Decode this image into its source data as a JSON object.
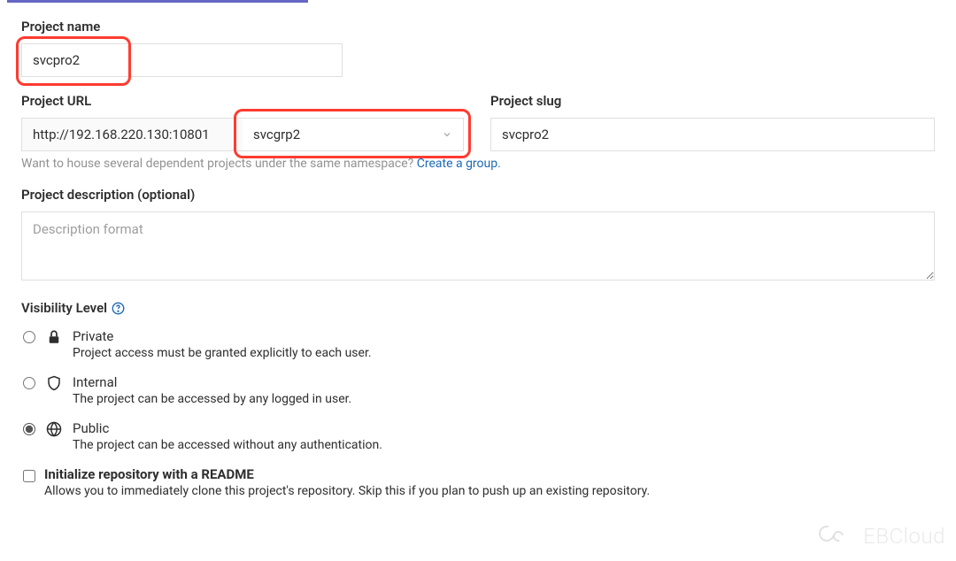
{
  "projectName": {
    "label": "Project name",
    "value": "svcpro2"
  },
  "projectUrl": {
    "label": "Project URL",
    "prefix": "http://192.168.220.130:10801",
    "namespace": "svcgrp2"
  },
  "projectSlug": {
    "label": "Project slug",
    "value": "svcpro2"
  },
  "namespaceHint": {
    "text": "Want to house several dependent projects under the same namespace? ",
    "linkText": "Create a group."
  },
  "description": {
    "label": "Project description (optional)",
    "placeholder": "Description format"
  },
  "visibility": {
    "label": "Visibility Level",
    "options": [
      {
        "title": "Private",
        "desc": "Project access must be granted explicitly to each user."
      },
      {
        "title": "Internal",
        "desc": "The project can be accessed by any logged in user."
      },
      {
        "title": "Public",
        "desc": "The project can be accessed without any authentication."
      }
    ]
  },
  "readme": {
    "label": "Initialize repository with a README",
    "desc": "Allows you to immediately clone this project's repository. Skip this if you plan to push up an existing repository."
  },
  "watermark": "EBCloud"
}
